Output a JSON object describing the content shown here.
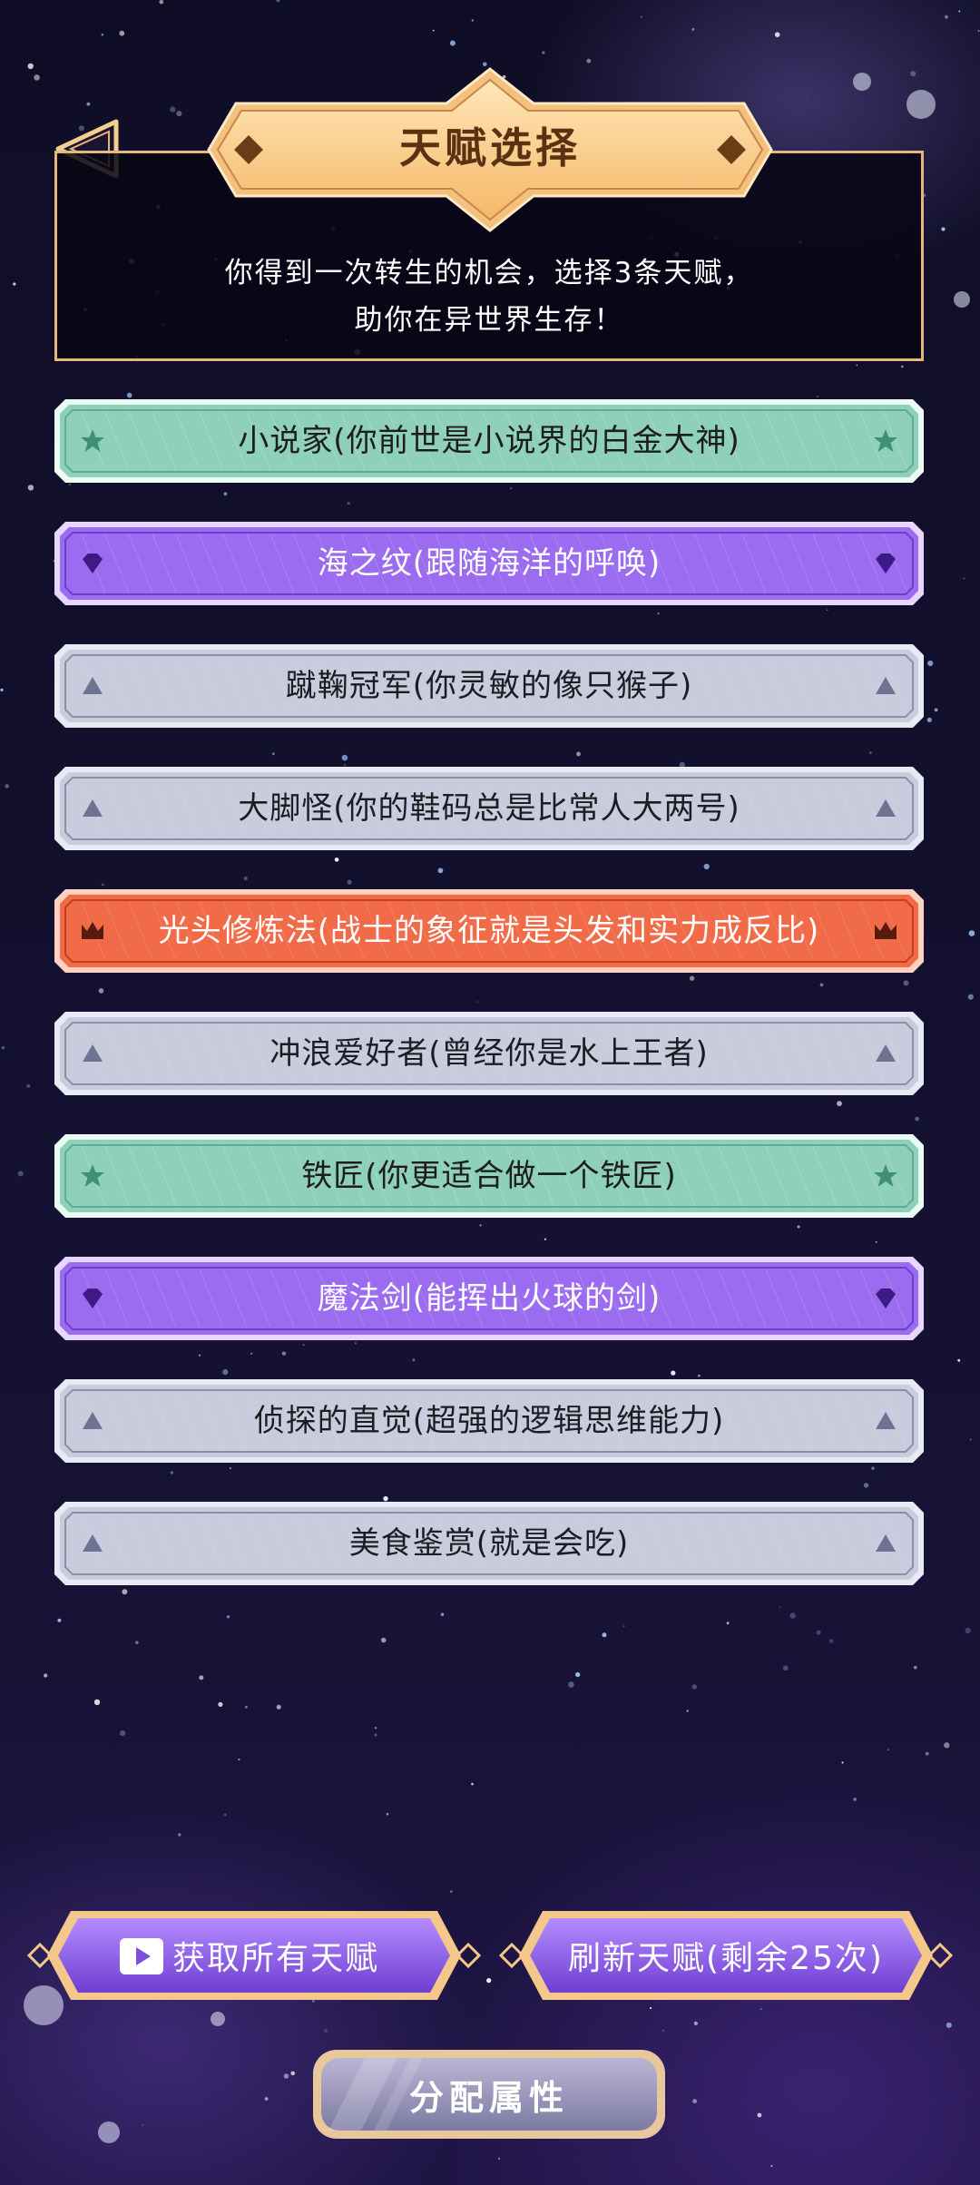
{
  "header": {
    "title": "天赋选择",
    "intro": "你得到一次转生的机会，选择3条天赋，\n助你在异世界生存！"
  },
  "talents": [
    {
      "label": "小说家(你前世是小说界的白金大神)",
      "rarity": "green",
      "icon": "star-icon"
    },
    {
      "label": "海之纹(跟随海洋的呼唤)",
      "rarity": "purple",
      "icon": "diamond-icon"
    },
    {
      "label": "蹴鞠冠军(你灵敏的像只猴子)",
      "rarity": "gray",
      "icon": "triangle-icon"
    },
    {
      "label": "大脚怪(你的鞋码总是比常人大两号)",
      "rarity": "gray",
      "icon": "triangle-icon"
    },
    {
      "label": "光头修炼法(战士的象征就是头发和实力成反比)",
      "rarity": "orange",
      "icon": "crown-icon"
    },
    {
      "label": "冲浪爱好者(曾经你是水上王者)",
      "rarity": "gray",
      "icon": "triangle-icon"
    },
    {
      "label": "铁匠(你更适合做一个铁匠)",
      "rarity": "green",
      "icon": "star-icon"
    },
    {
      "label": "魔法剑(能挥出火球的剑)",
      "rarity": "purple",
      "icon": "diamond-icon"
    },
    {
      "label": "侦探的直觉(超强的逻辑思维能力)",
      "rarity": "gray",
      "icon": "triangle-icon"
    },
    {
      "label": "美食鉴赏(就是会吃)",
      "rarity": "gray",
      "icon": "triangle-icon"
    }
  ],
  "buttons": {
    "get_all": "获取所有天赋",
    "refresh": "刷新天赋(剩余25次)",
    "allocate": "分配属性"
  },
  "colors": {
    "green": "#8fd1b8",
    "purple": "#9b6cf0",
    "gray": "#c9ccdd",
    "orange": "#f26b48",
    "gold_border": "#e6b877",
    "title_text": "#5a3211"
  }
}
